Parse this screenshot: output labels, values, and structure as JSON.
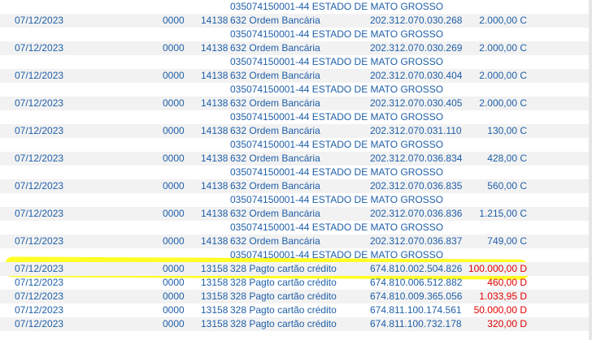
{
  "rows": [
    {
      "type": "desc",
      "desc": "035074150001-44 ESTADO DE MATO GROSSO"
    },
    {
      "type": "tx",
      "date": "07/12/2023",
      "agencia": "0000",
      "lote": "14138",
      "hist_code": "632",
      "hist": "Ordem Bancária",
      "doc": "202.312.070.030.268",
      "valor": "2.000,00 C",
      "neg": false
    },
    {
      "type": "desc",
      "desc": "035074150001-44 ESTADO DE MATO GROSSO"
    },
    {
      "type": "tx",
      "date": "07/12/2023",
      "agencia": "0000",
      "lote": "14138",
      "hist_code": "632",
      "hist": "Ordem Bancária",
      "doc": "202.312.070.030.269",
      "valor": "2.000,00 C",
      "neg": false
    },
    {
      "type": "desc",
      "desc": "035074150001-44 ESTADO DE MATO GROSSO"
    },
    {
      "type": "tx",
      "date": "07/12/2023",
      "agencia": "0000",
      "lote": "14138",
      "hist_code": "632",
      "hist": "Ordem Bancária",
      "doc": "202.312.070.030.404",
      "valor": "2.000,00 C",
      "neg": false
    },
    {
      "type": "desc",
      "desc": "035074150001-44 ESTADO DE MATO GROSSO"
    },
    {
      "type": "tx",
      "date": "07/12/2023",
      "agencia": "0000",
      "lote": "14138",
      "hist_code": "632",
      "hist": "Ordem Bancária",
      "doc": "202.312.070.030.405",
      "valor": "2.000,00 C",
      "neg": false
    },
    {
      "type": "desc",
      "desc": "035074150001-44 ESTADO DE MATO GROSSO"
    },
    {
      "type": "tx",
      "date": "07/12/2023",
      "agencia": "0000",
      "lote": "14138",
      "hist_code": "632",
      "hist": "Ordem Bancária",
      "doc": "202.312.070.031.110",
      "valor": "130,00 C",
      "neg": false
    },
    {
      "type": "desc",
      "desc": "035074150001-44 ESTADO DE MATO GROSSO"
    },
    {
      "type": "tx",
      "date": "07/12/2023",
      "agencia": "0000",
      "lote": "14138",
      "hist_code": "632",
      "hist": "Ordem Bancária",
      "doc": "202.312.070.036.834",
      "valor": "428,00 C",
      "neg": false
    },
    {
      "type": "desc",
      "desc": "035074150001-44 ESTADO DE MATO GROSSO"
    },
    {
      "type": "tx",
      "date": "07/12/2023",
      "agencia": "0000",
      "lote": "14138",
      "hist_code": "632",
      "hist": "Ordem Bancária",
      "doc": "202.312.070.036.835",
      "valor": "560,00 C",
      "neg": false
    },
    {
      "type": "desc",
      "desc": "035074150001-44 ESTADO DE MATO GROSSO"
    },
    {
      "type": "tx",
      "date": "07/12/2023",
      "agencia": "0000",
      "lote": "14138",
      "hist_code": "632",
      "hist": "Ordem Bancária",
      "doc": "202.312.070.036.836",
      "valor": "1.215,00 C",
      "neg": false
    },
    {
      "type": "desc",
      "desc": "035074150001-44 ESTADO DE MATO GROSSO"
    },
    {
      "type": "tx",
      "date": "07/12/2023",
      "agencia": "0000",
      "lote": "14138",
      "hist_code": "632",
      "hist": "Ordem Bancária",
      "doc": "202.312.070.036.837",
      "valor": "749,00 C",
      "neg": false
    },
    {
      "type": "desc",
      "desc": "035074150001-44 ESTADO DE MATO GROSSO"
    },
    {
      "type": "tx",
      "date": "07/12/2023",
      "agencia": "0000",
      "lote": "13158",
      "hist_code": "328",
      "hist": "Pagto cartão crédito",
      "doc": "674.810.002.504.826",
      "valor": "100.000,00 D",
      "neg": true
    },
    {
      "type": "tx",
      "date": "07/12/2023",
      "agencia": "0000",
      "lote": "13158",
      "hist_code": "328",
      "hist": "Pagto cartão crédito",
      "doc": "674.810.006.512.882",
      "valor": "460,00 D",
      "neg": true
    },
    {
      "type": "tx",
      "date": "07/12/2023",
      "agencia": "0000",
      "lote": "13158",
      "hist_code": "328",
      "hist": "Pagto cartão crédito",
      "doc": "674.810.009.365.056",
      "valor": "1.033,95 D",
      "neg": true
    },
    {
      "type": "tx",
      "date": "07/12/2023",
      "agencia": "0000",
      "lote": "13158",
      "hist_code": "328",
      "hist": "Pagto cartão crédito",
      "doc": "674.811.100.174.561",
      "valor": "50.000,00 D",
      "neg": true
    },
    {
      "type": "tx",
      "date": "07/12/2023",
      "agencia": "0000",
      "lote": "13158",
      "hist_code": "328",
      "hist": "Pagto cartão crédito",
      "doc": "674.811.100.732.178",
      "valor": "320,00 D",
      "neg": true
    }
  ],
  "highlight_row_index": 19,
  "colors": {
    "text": "#1f5fa8",
    "debit": "#e00000",
    "stripe": "#f2f2f2",
    "highlight": "#ffff00"
  }
}
